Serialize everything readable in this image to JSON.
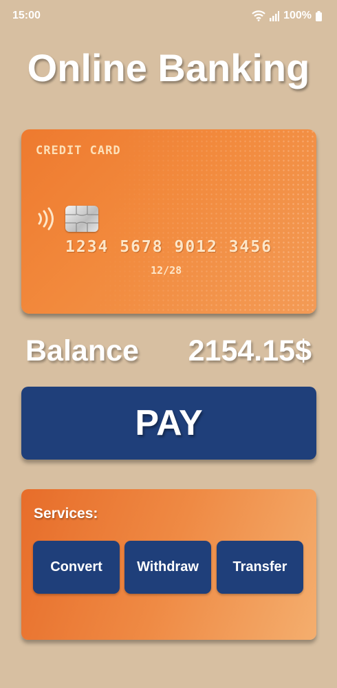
{
  "status": {
    "time": "15:00",
    "battery": "100%",
    "icons": [
      "wifi-icon",
      "signal-icon",
      "battery-icon"
    ]
  },
  "app": {
    "title": "Online Banking"
  },
  "card": {
    "label": "CREDIT CARD",
    "number": "1234 5678 9012 3456",
    "expiry": "12/28",
    "icons": [
      "contactless-icon",
      "chip-icon"
    ]
  },
  "balance": {
    "label": "Balance",
    "value": "2154.15$"
  },
  "pay": {
    "label": "PAY"
  },
  "services": {
    "title": "Services:",
    "items": [
      {
        "label": "Convert"
      },
      {
        "label": "Withdraw"
      },
      {
        "label": "Transfer"
      }
    ]
  },
  "colors": {
    "background": "#d7bfa1",
    "card_orange": "#f28a3d",
    "button_blue": "#1f3f7a",
    "text_white": "#ffffff"
  }
}
